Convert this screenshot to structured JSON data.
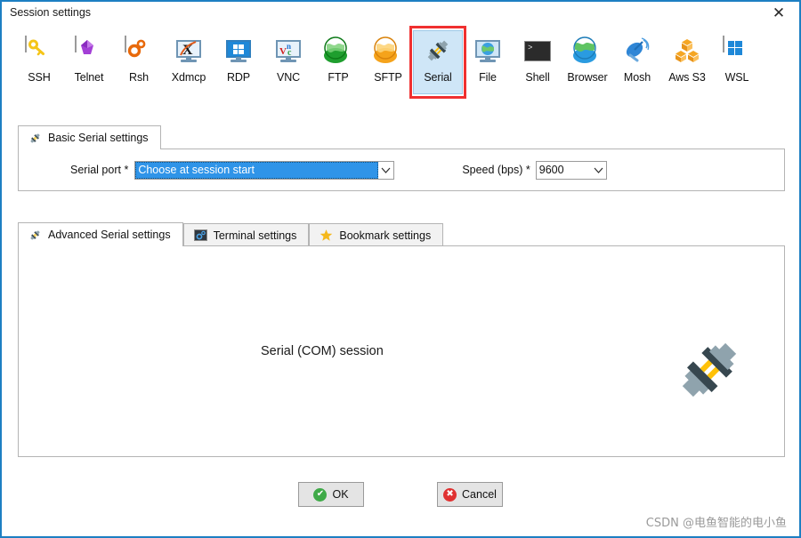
{
  "window": {
    "title": "Session settings",
    "close_label": "✕",
    "close_icon": "close-icon",
    "border_color": "#1d7fc3"
  },
  "session_types": {
    "selected": "Serial",
    "annotation_color": "#f03030",
    "items": [
      {
        "label": "SSH",
        "icon": "key-icon"
      },
      {
        "label": "Telnet",
        "icon": "gem-icon"
      },
      {
        "label": "Rsh",
        "icon": "gears-icon"
      },
      {
        "label": "Xdmcp",
        "icon": "x-monitor-icon"
      },
      {
        "label": "RDP",
        "icon": "windows-monitor-icon"
      },
      {
        "label": "VNC",
        "icon": "vnc-monitor-icon"
      },
      {
        "label": "FTP",
        "icon": "green-globe-icon"
      },
      {
        "label": "SFTP",
        "icon": "orange-globe-icon"
      },
      {
        "label": "Serial",
        "icon": "serial-plug-icon"
      },
      {
        "label": "File",
        "icon": "file-monitor-icon"
      },
      {
        "label": "Shell",
        "icon": "terminal-icon"
      },
      {
        "label": "Browser",
        "icon": "blue-globe-icon"
      },
      {
        "label": "Mosh",
        "icon": "satellite-dish-icon"
      },
      {
        "label": "Aws S3",
        "icon": "aws-cubes-icon"
      },
      {
        "label": "WSL",
        "icon": "windows-logo-icon"
      }
    ]
  },
  "basic_settings": {
    "tab_label": "Basic Serial settings",
    "tab_icon": "serial-plug-icon",
    "serial_port": {
      "label": "Serial port *",
      "value": "Choose at session start",
      "placeholder": "Choose at session start",
      "highlight_color": "#2f94e8"
    },
    "speed": {
      "label": "Speed (bps) *",
      "value": "9600"
    }
  },
  "lower_tabs": {
    "active": "Advanced Serial settings",
    "items": [
      {
        "label": "Advanced Serial settings",
        "icon": "serial-plug-icon"
      },
      {
        "label": "Terminal settings",
        "icon": "terminal-settings-icon"
      },
      {
        "label": "Bookmark settings",
        "icon": "star-icon"
      }
    ]
  },
  "advanced_panel": {
    "caption": "Serial (COM) session",
    "illustration_icon": "serial-plug-illustration"
  },
  "footer": {
    "ok": {
      "label": "OK",
      "icon": "check-circle-icon",
      "glyph": "✔",
      "color": "#3faa48"
    },
    "cancel": {
      "label": "Cancel",
      "icon": "error-circle-icon",
      "glyph": "✖",
      "color": "#e03131"
    }
  },
  "watermark": {
    "text": "CSDN @电鱼智能的电小鱼"
  }
}
